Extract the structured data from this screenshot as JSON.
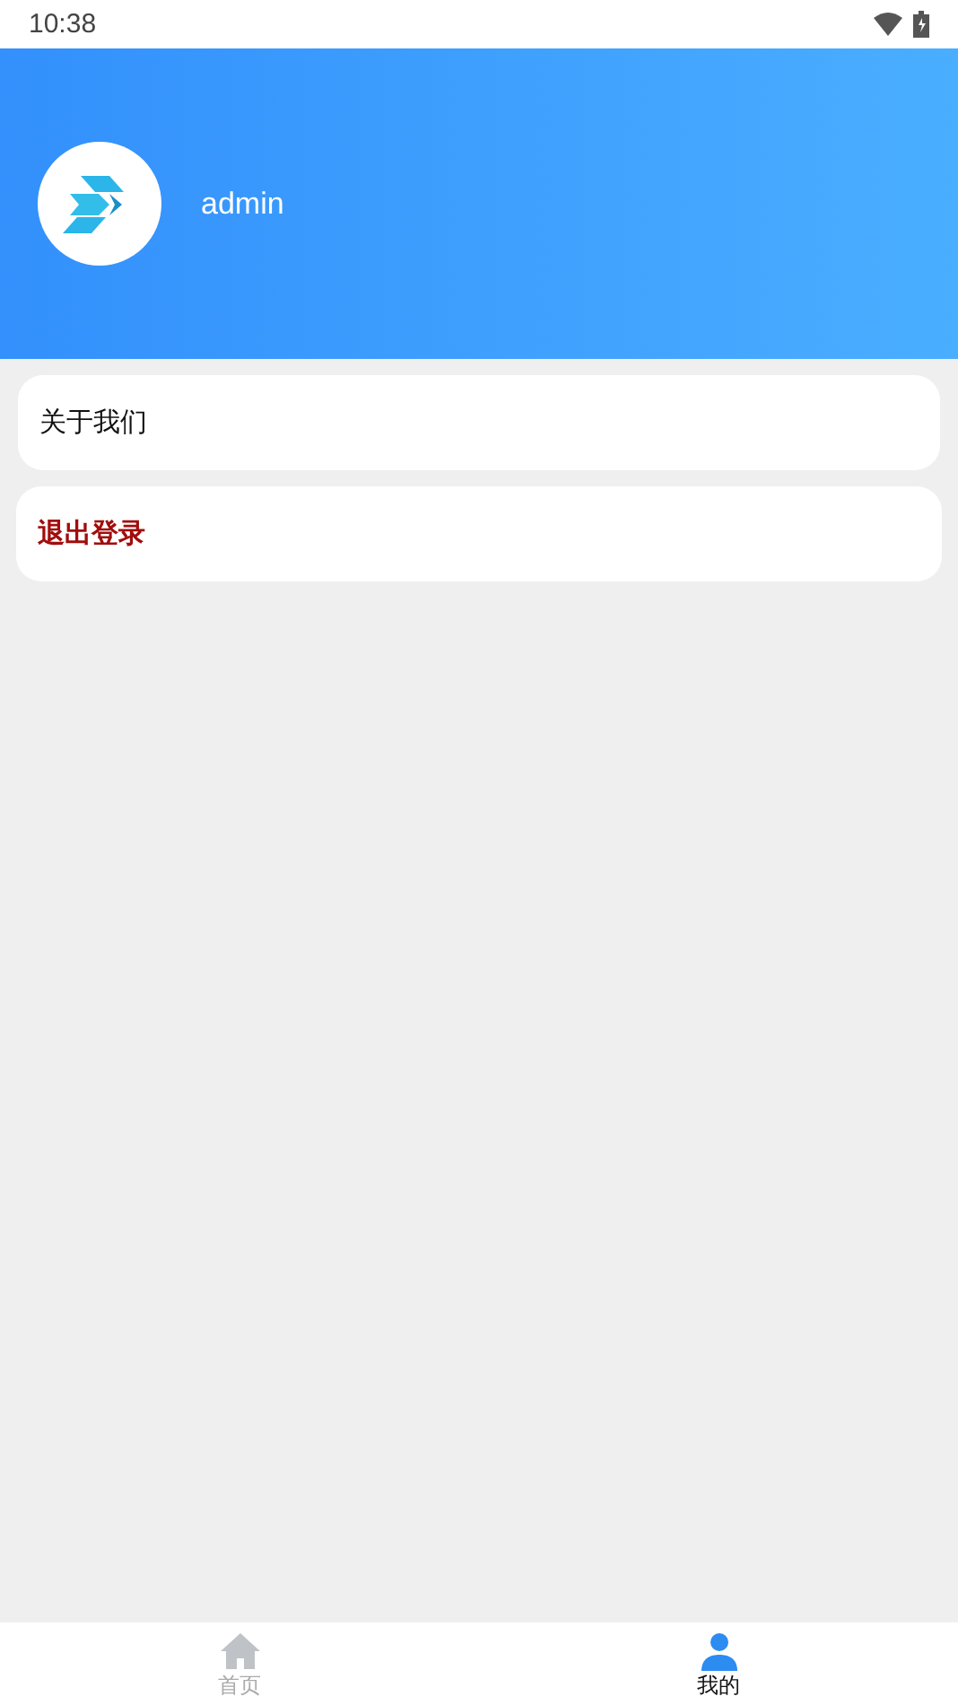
{
  "status_bar": {
    "time": "10:38"
  },
  "profile": {
    "username": "admin"
  },
  "menu": [
    {
      "label": "关于我们",
      "kind": "normal"
    },
    {
      "label": "退出登录",
      "kind": "danger"
    }
  ],
  "tabs": [
    {
      "label": "首页",
      "kind": "home",
      "selected": false
    },
    {
      "label": "我的",
      "kind": "user",
      "selected": true
    }
  ]
}
